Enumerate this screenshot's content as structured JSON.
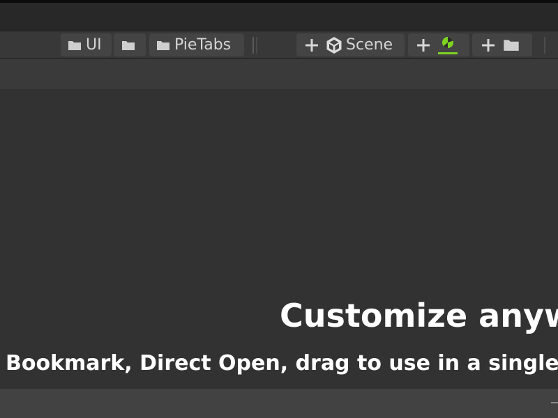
{
  "toolbar": {
    "tab_ui_label": "UI",
    "tab_pietabs_label": "PieTabs",
    "tab_scene_label": "Scene"
  },
  "icons": {
    "folder": "folder-icon",
    "plus": "plus-icon",
    "unity": "unity-logo-icon",
    "pie": "pie-chart-icon"
  },
  "promo": {
    "headline": "Customize anyw",
    "subline": "Bookmark, Direct Open, drag to use in a single but"
  },
  "colors": {
    "background": "#323232",
    "toolbar": "#383838",
    "button": "#444444",
    "accent_green": "#7ed321",
    "text": "#ffffff"
  }
}
